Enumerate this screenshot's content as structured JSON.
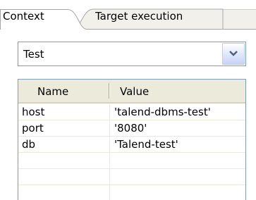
{
  "tabs": [
    {
      "label": "Context",
      "active": true
    },
    {
      "label": "Target execution",
      "active": false
    }
  ],
  "context_select": {
    "value": "Test",
    "dropdown_icon": "chevron-down-icon"
  },
  "table": {
    "columns": [
      "Name",
      "Value"
    ],
    "rows": [
      {
        "name": "host",
        "value": "'talend-dbms-test'"
      },
      {
        "name": "port",
        "value": "'8080'"
      },
      {
        "name": "db",
        "value": "'Talend-test'"
      },
      {
        "name": "",
        "value": ""
      },
      {
        "name": "",
        "value": ""
      }
    ]
  },
  "colors": {
    "border": "#7f9db9",
    "header_bg": "#ebeadb",
    "tab_inactive_bg": "#f1f0ea",
    "combo_button": "#c6d3f7",
    "chevron": "#4d6185"
  }
}
